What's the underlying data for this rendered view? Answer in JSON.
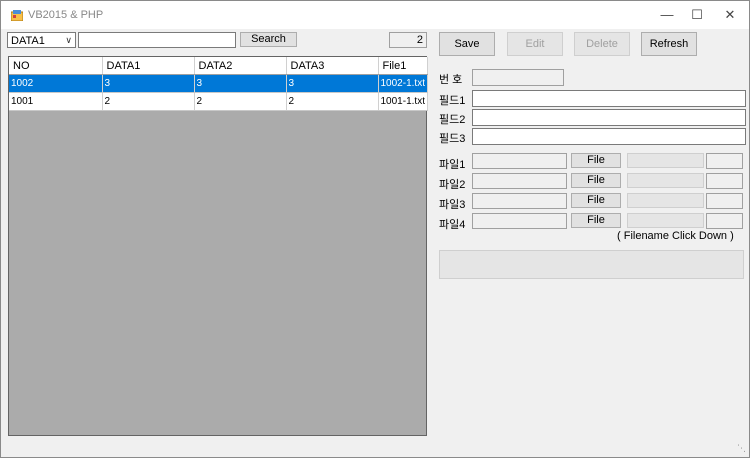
{
  "window": {
    "title": "VB2015 & PHP"
  },
  "search": {
    "field_select": "DATA1",
    "query": "",
    "button": "Search",
    "count": "2"
  },
  "toolbar": {
    "save": "Save",
    "edit": "Edit",
    "delete": "Delete",
    "refresh": "Refresh"
  },
  "grid": {
    "columns": [
      "NO",
      "DATA1",
      "DATA2",
      "DATA3",
      "File1"
    ],
    "rows": [
      [
        "1002",
        "3",
        "3",
        "3",
        "1002-1.txt"
      ],
      [
        "1001",
        "2",
        "2",
        "2",
        "1001-1.txt"
      ]
    ]
  },
  "form": {
    "number_label": "번 호",
    "field1_label": "필드1",
    "field2_label": "필드2",
    "field3_label": "필드3",
    "file1_label": "파일1",
    "file2_label": "파일2",
    "file3_label": "파일3",
    "file4_label": "파일4",
    "file_button": "File",
    "hint": "( Filename Click Down )"
  }
}
